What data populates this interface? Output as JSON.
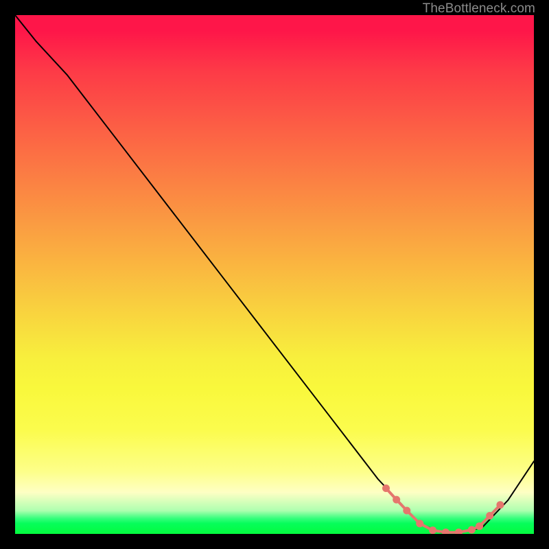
{
  "watermark": "TheBottleneck.com",
  "chart_data": {
    "type": "line",
    "title": "",
    "xlabel": "",
    "ylabel": "",
    "xlim": [
      0,
      100
    ],
    "ylim": [
      0,
      100
    ],
    "series": [
      {
        "name": "curve",
        "x": [
          0,
          4,
          10,
          20,
          30,
          40,
          50,
          60,
          70,
          78,
          82,
          86,
          90,
          95,
          100
        ],
        "y": [
          100,
          95,
          88.5,
          75.5,
          62.5,
          49.5,
          36.5,
          23.5,
          10.5,
          2.0,
          0.3,
          0.3,
          1.2,
          6.5,
          14.0
        ]
      }
    ],
    "markers": {
      "name": "highlight",
      "x": [
        71.5,
        73.5,
        75.5,
        78.0,
        80.5,
        83.0,
        85.5,
        88.0,
        89.5,
        91.5,
        93.5
      ],
      "y": [
        8.8,
        6.6,
        4.5,
        2.0,
        0.7,
        0.3,
        0.3,
        0.8,
        1.5,
        3.5,
        5.6
      ]
    },
    "colors": {
      "curve": "#000000",
      "markers": "#e5766d",
      "background_top": "#fe1649",
      "background_bottom": "#04fc3e"
    }
  }
}
